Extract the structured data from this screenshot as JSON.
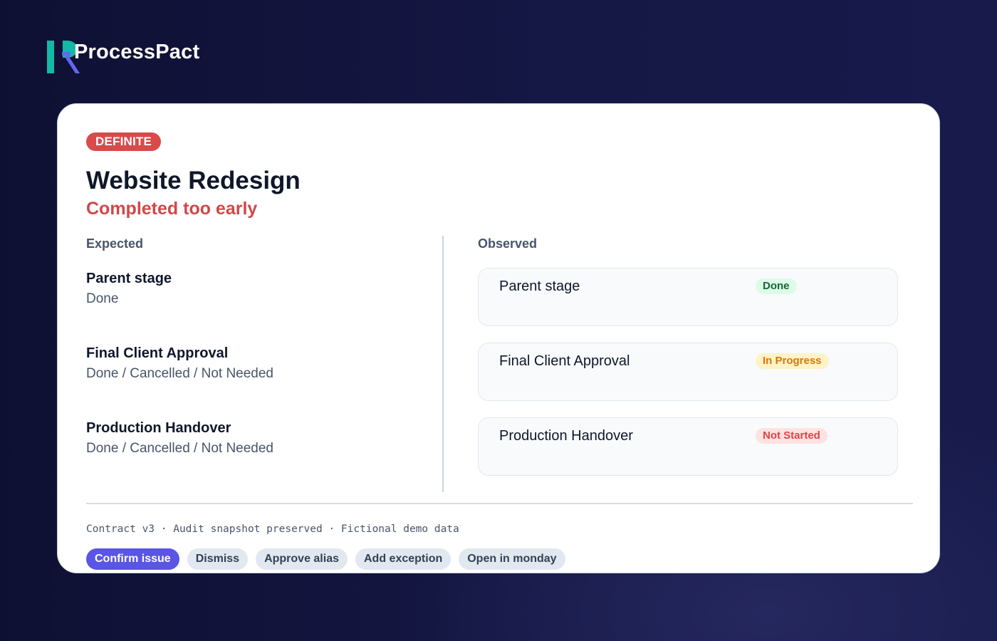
{
  "brand": {
    "name": "ProcessPact",
    "colors": {
      "teal": "#14b8a6",
      "indigo": "#6366f1"
    }
  },
  "issue": {
    "severity": "DEFINITE",
    "title": "Website Redesign",
    "subtitle": "Completed too early"
  },
  "expected": {
    "heading": "Expected",
    "items": [
      {
        "name": "Parent stage",
        "value": "Done"
      },
      {
        "name": "Final Client Approval",
        "value": "Done / Cancelled / Not Needed"
      },
      {
        "name": "Production Handover",
        "value": "Done / Cancelled / Not Needed"
      }
    ]
  },
  "observed": {
    "heading": "Observed",
    "items": [
      {
        "name": "Parent stage",
        "status": "Done"
      },
      {
        "name": "Final Client Approval",
        "status": "In Progress"
      },
      {
        "name": "Production Handover",
        "status": "Not Started"
      }
    ]
  },
  "footer": {
    "meta": "Contract v3 · Audit snapshot preserved · Fictional demo data"
  },
  "actions": [
    {
      "label": "Confirm issue"
    },
    {
      "label": "Dismiss"
    },
    {
      "label": "Approve alias"
    },
    {
      "label": "Add exception"
    },
    {
      "label": "Open in monday"
    }
  ],
  "status_colors": {
    "danger": "#d94a4a",
    "done_text": "#166534",
    "in_progress_text": "#d97706",
    "not_started_text": "#dc4444",
    "primary_action": "#5b55e6"
  }
}
